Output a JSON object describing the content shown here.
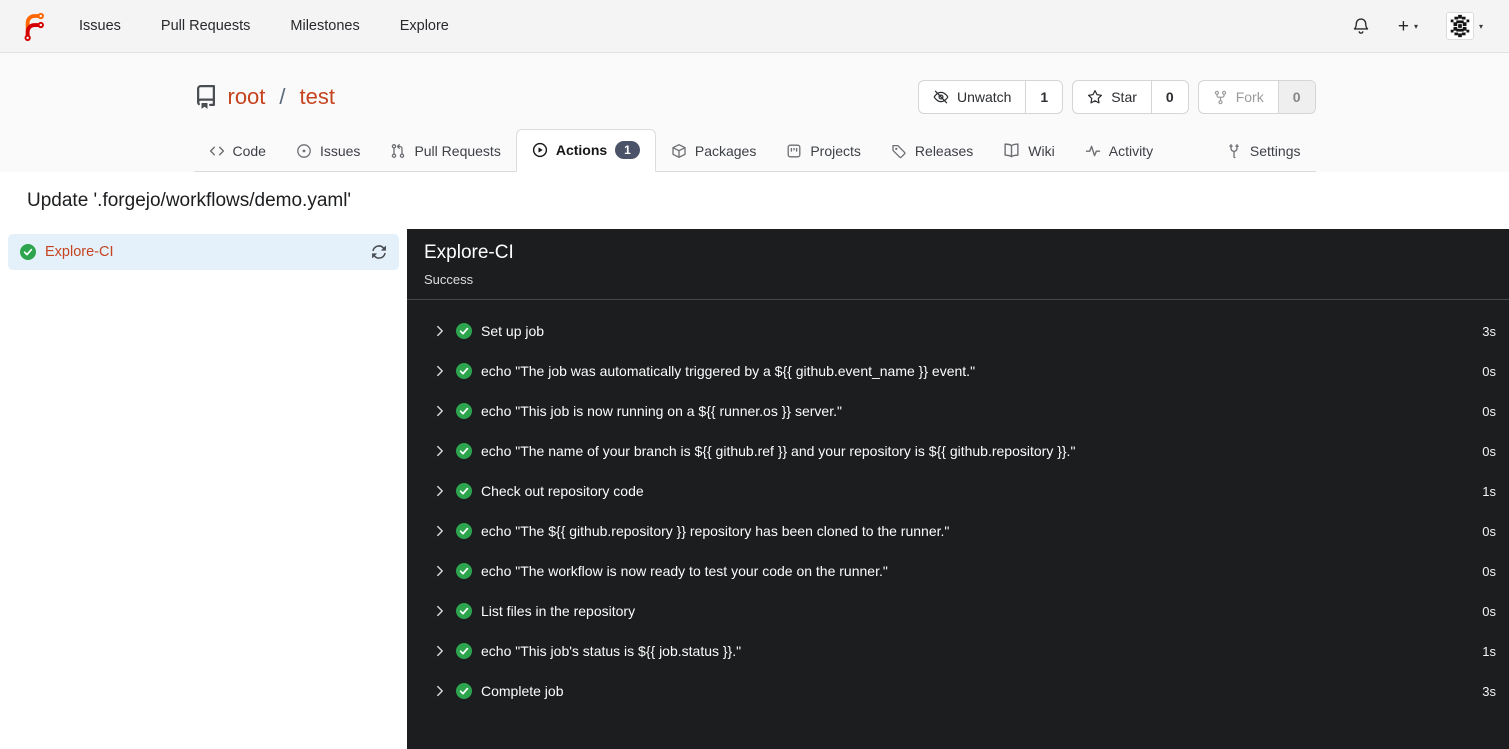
{
  "colors": {
    "accent": "#c5441f",
    "success_green": "#2da44e",
    "log_panel_bg": "#1b1d1e",
    "selected_job_bg": "#e4f1fb",
    "tab_badge_bg": "#4b5368"
  },
  "icons": {
    "logo": "forgejo-logo",
    "bell": "notifications",
    "plus": "create-new",
    "avatar": "identicon",
    "repo": "book",
    "unwatch": "eye-slash",
    "star": "star-outline",
    "fork": "git-fork",
    "job_status": "green-check-circle",
    "refresh": "sync-arrows",
    "step_expander": "chevron-right"
  },
  "topnav": {
    "links": [
      {
        "label": "Issues"
      },
      {
        "label": "Pull Requests"
      },
      {
        "label": "Milestones"
      },
      {
        "label": "Explore"
      }
    ],
    "plus_label": "+"
  },
  "repo": {
    "owner": "root",
    "separator": "/",
    "name": "test",
    "buttons": [
      {
        "label": "Unwatch",
        "count": "1"
      },
      {
        "label": "Star",
        "count": "0"
      },
      {
        "label": "Fork",
        "count": "0"
      }
    ],
    "tabs": [
      {
        "label": "Code"
      },
      {
        "label": "Issues"
      },
      {
        "label": "Pull Requests"
      },
      {
        "label": "Actions",
        "badge": "1",
        "active": true
      },
      {
        "label": "Packages"
      },
      {
        "label": "Projects"
      },
      {
        "label": "Releases"
      },
      {
        "label": "Wiki"
      },
      {
        "label": "Activity"
      },
      {
        "label": "Settings"
      }
    ]
  },
  "run": {
    "title": "Update '.forgejo/workflows/demo.yaml'",
    "jobs": [
      {
        "name": "Explore-CI",
        "status": "success"
      }
    ],
    "panel": {
      "job_name": "Explore-CI",
      "status_text": "Success"
    },
    "steps": [
      {
        "name": "Set up job",
        "duration": "3s"
      },
      {
        "name": "echo \"The job was automatically triggered by a ${{ github.event_name }} event.\"",
        "duration": "0s"
      },
      {
        "name": "echo \"This job is now running on a ${{ runner.os }} server.\"",
        "duration": "0s"
      },
      {
        "name": "echo \"The name of your branch is ${{ github.ref }} and your repository is ${{ github.repository }}.\"",
        "duration": "0s"
      },
      {
        "name": "Check out repository code",
        "duration": "1s"
      },
      {
        "name": "echo \"The ${{ github.repository }} repository has been cloned to the runner.\"",
        "duration": "0s"
      },
      {
        "name": "echo \"The workflow is now ready to test your code on the runner.\"",
        "duration": "0s"
      },
      {
        "name": "List files in the repository",
        "duration": "0s"
      },
      {
        "name": "echo \"This job's status is ${{ job.status }}.\"",
        "duration": "1s"
      },
      {
        "name": "Complete job",
        "duration": "3s"
      }
    ]
  }
}
